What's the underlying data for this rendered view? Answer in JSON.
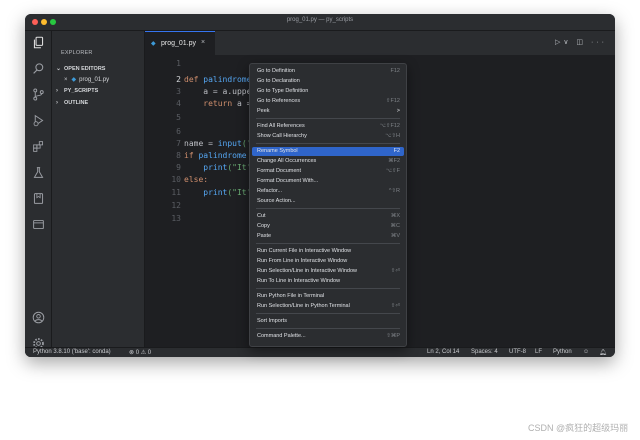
{
  "window": {
    "title": "prog_01.py — py_scripts",
    "dots": [
      "#fe5f57",
      "#febc2e",
      "#28c840"
    ]
  },
  "activity_icons": [
    "files-icon",
    "search-icon",
    "source-control-icon",
    "run-debug-icon",
    "extensions-icon",
    "testing-icon",
    "bookmark-icon",
    "remote-explorer-icon",
    "account-icon",
    "settings-gear-icon"
  ],
  "sidebar": {
    "title": "EXPLORER",
    "more": "···",
    "open_editors": "OPEN EDITORS",
    "open_file": "prog_01.py",
    "py_scripts": "PY_SCRIPTS",
    "outline": "OUTLINE"
  },
  "tab": {
    "label": "prog_01.py",
    "close": "×"
  },
  "editor_actions": "▷∨ ◫ ···",
  "code": {
    "line_numbers": [
      "1",
      "2",
      "3",
      "4",
      "5",
      "6",
      "7",
      "8",
      "9",
      "10",
      "11",
      "12",
      "13"
    ],
    "active_line": "2",
    "l2_kw": "def ",
    "l2_fn": "palindrome",
    "l3": "    a = a.upper",
    "l4_kw": "    return ",
    "l4_rest": "a =",
    "l7_a": "name = ",
    "l7_b": "input",
    "l7_c": "('",
    "l8_kw": "if ",
    "l8_fn": "palindrome",
    "l9_a": "    ",
    "l9_fn": "print",
    "l9_b": "(\"It'",
    "l10_kw": "else:",
    "l11_a": "    ",
    "l11_fn": "print",
    "l11_b": "(\"It'"
  },
  "context_menu": {
    "items": [
      {
        "label": "Go to Definition",
        "shortcut": "F12"
      },
      {
        "label": "Go to Declaration",
        "shortcut": ""
      },
      {
        "label": "Go to Type Definition",
        "shortcut": ""
      },
      {
        "label": "Go to References",
        "shortcut": "⇧F12"
      },
      {
        "label": "Peek",
        "shortcut": ">"
      },
      {
        "label": "Find All References",
        "shortcut": "⌥⇧F12"
      },
      {
        "label": "Show Call Hierarchy",
        "shortcut": "⌥⇧H"
      },
      {
        "label": "Rename Symbol",
        "shortcut": "F2"
      },
      {
        "label": "Change All Occurrences",
        "shortcut": "⌘F2"
      },
      {
        "label": "Format Document",
        "shortcut": "⌥⇧F"
      },
      {
        "label": "Format Document With...",
        "shortcut": ""
      },
      {
        "label": "Refactor...",
        "shortcut": "^⇧R"
      },
      {
        "label": "Source Action...",
        "shortcut": ""
      },
      {
        "label": "Cut",
        "shortcut": "⌘X"
      },
      {
        "label": "Copy",
        "shortcut": "⌘C"
      },
      {
        "label": "Paste",
        "shortcut": "⌘V"
      },
      {
        "label": "Run Current File in Interactive Window",
        "shortcut": ""
      },
      {
        "label": "Run From Line in Interactive Window",
        "shortcut": ""
      },
      {
        "label": "Run Selection/Line in Interactive Window",
        "shortcut": "⇧⏎"
      },
      {
        "label": "Run To Line in Interactive Window",
        "shortcut": ""
      },
      {
        "label": "Run Python File in Terminal",
        "shortcut": ""
      },
      {
        "label": "Run Selection/Line in Python Terminal",
        "shortcut": "⇧⏎"
      },
      {
        "label": "Sort Imports",
        "shortcut": ""
      },
      {
        "label": "Command Palette...",
        "shortcut": "⇧⌘P"
      }
    ],
    "highlighted": "Rename Symbol"
  },
  "statusbar": {
    "interpreter": "Python 3.8.10 ('base': conda)",
    "problems": "⊗ 0 ⚠ 0",
    "position": "Ln 2, Col 14",
    "spaces": "Spaces: 4",
    "encoding": "UTF-8",
    "eol": "LF",
    "language": "Python",
    "icons": [
      "feedback-icon",
      "bell-icon"
    ]
  },
  "watermark": "CSDN @疯狂的超级玛丽"
}
